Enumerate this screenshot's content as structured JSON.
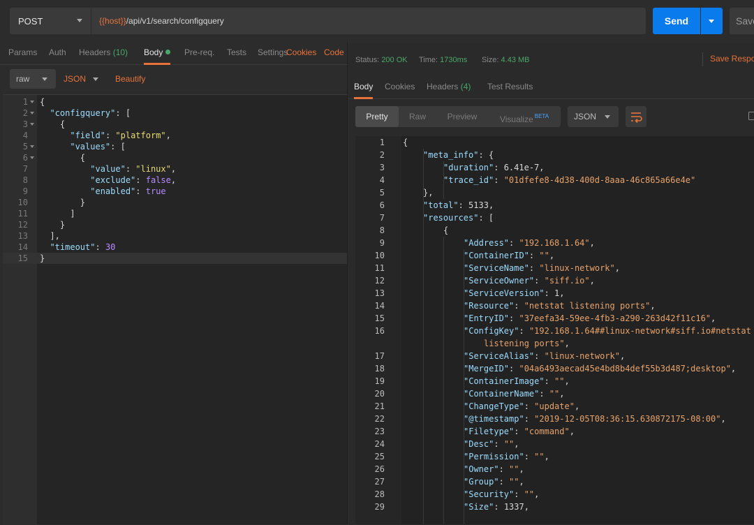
{
  "request": {
    "method": "POST",
    "url_var": "{{host}}",
    "url_path": "/api/v1/search/configquery",
    "send_label": "Send",
    "save_label": "Save"
  },
  "req_tabs": {
    "params": "Params",
    "auth": "Auth",
    "headers": "Headers",
    "headers_count": "(10)",
    "body": "Body",
    "prereq": "Pre-req.",
    "tests": "Tests",
    "settings": "Settings",
    "cookies": "Cookies",
    "code": "Code"
  },
  "body_opts": {
    "mode": "raw",
    "format": "JSON",
    "beautify": "Beautify"
  },
  "request_body_lines": [
    {
      "n": "1",
      "fold": true
    },
    {
      "n": "2",
      "fold": true
    },
    {
      "n": "3",
      "fold": true
    },
    {
      "n": "4",
      "fold": false
    },
    {
      "n": "5",
      "fold": true
    },
    {
      "n": "6",
      "fold": true
    },
    {
      "n": "7",
      "fold": false
    },
    {
      "n": "8",
      "fold": false
    },
    {
      "n": "9",
      "fold": false
    },
    {
      "n": "10",
      "fold": false
    },
    {
      "n": "11",
      "fold": false
    },
    {
      "n": "12",
      "fold": false
    },
    {
      "n": "13",
      "fold": false
    },
    {
      "n": "14",
      "fold": false
    },
    {
      "n": "15",
      "fold": false
    }
  ],
  "request_body_text": {
    "configquery_key": "\"configquery\"",
    "field_key": "\"field\"",
    "field_val": "\"platform\"",
    "values_key": "\"values\"",
    "value_key": "\"value\"",
    "value_val": "\"linux\"",
    "exclude_key": "\"exclude\"",
    "exclude_val": "false",
    "enabled_key": "\"enabled\"",
    "enabled_val": "true",
    "timeout_key": "\"timeout\"",
    "timeout_val": "30"
  },
  "status": {
    "status_label": "Status:",
    "status_value": "200 OK",
    "time_label": "Time:",
    "time_value": "1730ms",
    "size_label": "Size:",
    "size_value": "4.43 MB",
    "save_response": "Save Response"
  },
  "resp_tabs": {
    "body": "Body",
    "cookies": "Cookies",
    "headers": "Headers",
    "headers_count": "(4)",
    "test_results": "Test Results"
  },
  "view": {
    "pretty": "Pretty",
    "raw": "Raw",
    "preview": "Preview",
    "visualize": "Visualize",
    "beta": "BETA",
    "format": "JSON"
  },
  "response_lines": [
    {
      "n": "1",
      "indent": 0,
      "k": "",
      "v": "",
      "pre": "{",
      "post": ""
    },
    {
      "n": "2",
      "indent": 1,
      "k": "\"meta_info\"",
      "v": "",
      "pre": "",
      "post": ": {"
    },
    {
      "n": "3",
      "indent": 2,
      "k": "\"duration\"",
      "v": "6.41e-7",
      "vtype": "n",
      "pre": "",
      "post": ","
    },
    {
      "n": "4",
      "indent": 2,
      "k": "\"trace_id\"",
      "v": "\"01dfefe8-4d38-400d-8aaa-46c865a66e4e\"",
      "vtype": "s",
      "pre": "",
      "post": ""
    },
    {
      "n": "5",
      "indent": 1,
      "k": "",
      "v": "",
      "pre": "},",
      "post": ""
    },
    {
      "n": "6",
      "indent": 1,
      "k": "\"total\"",
      "v": "5133",
      "vtype": "n",
      "pre": "",
      "post": ","
    },
    {
      "n": "7",
      "indent": 1,
      "k": "\"resources\"",
      "v": "",
      "pre": "",
      "post": ": ["
    },
    {
      "n": "8",
      "indent": 2,
      "k": "",
      "v": "",
      "pre": "{",
      "post": ""
    },
    {
      "n": "9",
      "indent": 3,
      "k": "\"Address\"",
      "v": "\"192.168.1.64\"",
      "vtype": "s",
      "pre": "",
      "post": ","
    },
    {
      "n": "10",
      "indent": 3,
      "k": "\"ContainerID\"",
      "v": "\"\"",
      "vtype": "s",
      "pre": "",
      "post": ","
    },
    {
      "n": "11",
      "indent": 3,
      "k": "\"ServiceName\"",
      "v": "\"linux-network\"",
      "vtype": "s",
      "pre": "",
      "post": ","
    },
    {
      "n": "12",
      "indent": 3,
      "k": "\"ServiceOwner\"",
      "v": "\"siff.io\"",
      "vtype": "s",
      "pre": "",
      "post": ","
    },
    {
      "n": "13",
      "indent": 3,
      "k": "\"ServiceVersion\"",
      "v": "1",
      "vtype": "n",
      "pre": "",
      "post": ","
    },
    {
      "n": "14",
      "indent": 3,
      "k": "\"Resource\"",
      "v": "\"netstat listening ports\"",
      "vtype": "s",
      "pre": "",
      "post": ","
    },
    {
      "n": "15",
      "indent": 3,
      "k": "\"EntryID\"",
      "v": "\"37eefa34-59ee-4fb3-a290-263d42f11c16\"",
      "vtype": "s",
      "pre": "",
      "post": ","
    },
    {
      "n": "16",
      "indent": 3,
      "k": "\"ConfigKey\"",
      "v": "\"192.168.1.64##linux-network#siff.io#netstat",
      "vtype": "s",
      "pre": "",
      "post": ""
    },
    {
      "n": "",
      "indent": 4,
      "k": "",
      "v": "listening ports\"",
      "vtype": "s",
      "pre": "",
      "post": ","
    },
    {
      "n": "17",
      "indent": 3,
      "k": "\"ServiceAlias\"",
      "v": "\"linux-network\"",
      "vtype": "s",
      "pre": "",
      "post": ","
    },
    {
      "n": "18",
      "indent": 3,
      "k": "\"MergeID\"",
      "v": "\"04a6493aecad45e4bd8b4def55b3d487;desktop\"",
      "vtype": "s",
      "pre": "",
      "post": ","
    },
    {
      "n": "19",
      "indent": 3,
      "k": "\"ContainerImage\"",
      "v": "\"\"",
      "vtype": "s",
      "pre": "",
      "post": ","
    },
    {
      "n": "20",
      "indent": 3,
      "k": "\"ContainerName\"",
      "v": "\"\"",
      "vtype": "s",
      "pre": "",
      "post": ","
    },
    {
      "n": "21",
      "indent": 3,
      "k": "\"ChangeType\"",
      "v": "\"update\"",
      "vtype": "s",
      "pre": "",
      "post": ","
    },
    {
      "n": "22",
      "indent": 3,
      "k": "\"@timestamp\"",
      "v": "\"2019-12-05T08:36:15.630872175-08:00\"",
      "vtype": "s",
      "pre": "",
      "post": ","
    },
    {
      "n": "23",
      "indent": 3,
      "k": "\"Filetype\"",
      "v": "\"command\"",
      "vtype": "s",
      "pre": "",
      "post": ","
    },
    {
      "n": "24",
      "indent": 3,
      "k": "\"Desc\"",
      "v": "\"\"",
      "vtype": "s",
      "pre": "",
      "post": ","
    },
    {
      "n": "25",
      "indent": 3,
      "k": "\"Permission\"",
      "v": "\"\"",
      "vtype": "s",
      "pre": "",
      "post": ","
    },
    {
      "n": "26",
      "indent": 3,
      "k": "\"Owner\"",
      "v": "\"\"",
      "vtype": "s",
      "pre": "",
      "post": ","
    },
    {
      "n": "27",
      "indent": 3,
      "k": "\"Group\"",
      "v": "\"\"",
      "vtype": "s",
      "pre": "",
      "post": ","
    },
    {
      "n": "28",
      "indent": 3,
      "k": "\"Security\"",
      "v": "\"\"",
      "vtype": "s",
      "pre": "",
      "post": ","
    },
    {
      "n": "29",
      "indent": 3,
      "k": "\"Size\"",
      "v": "1337",
      "vtype": "n",
      "pre": "",
      "post": ","
    }
  ],
  "colors": {
    "accent": "#e8733a",
    "send": "#097bed",
    "success": "#4aa86a"
  }
}
